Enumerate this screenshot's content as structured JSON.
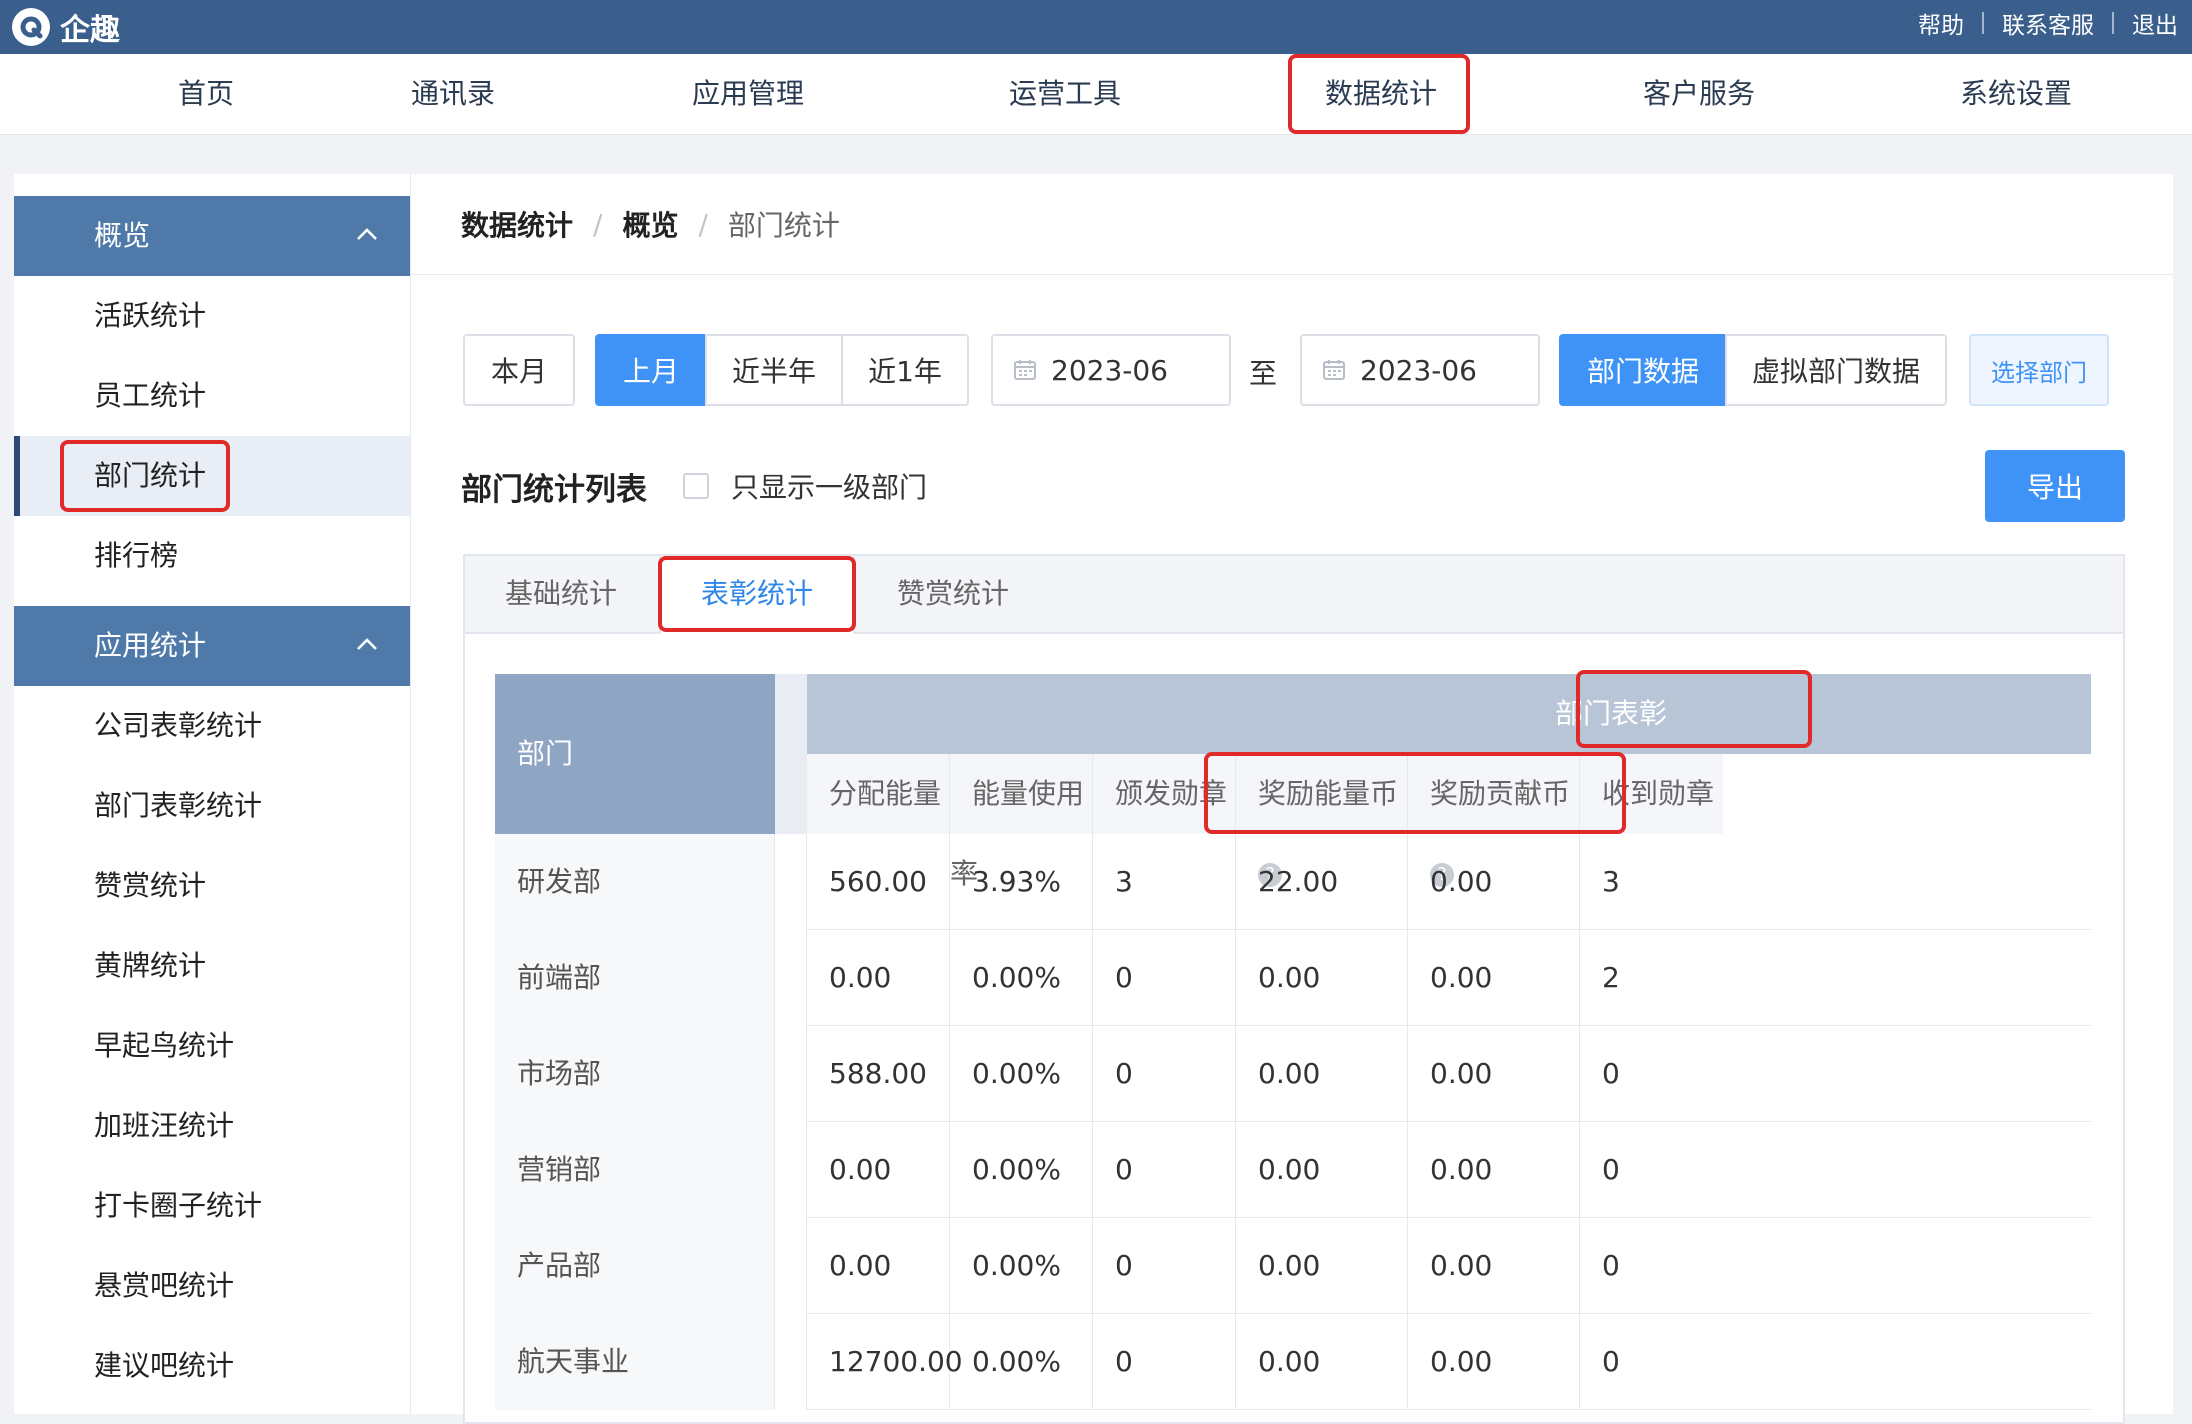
{
  "app": {
    "name": "企趣"
  },
  "top_links": [
    "帮助",
    "联系客服",
    "退出"
  ],
  "nav": [
    "首页",
    "通讯录",
    "应用管理",
    "运营工具",
    "数据统计",
    "客户服务",
    "系统设置"
  ],
  "sidebar": {
    "groups": [
      {
        "label": "概览",
        "items": [
          "活跃统计",
          "员工统计",
          "部门统计",
          "排行榜"
        ]
      },
      {
        "label": "应用统计",
        "items": [
          "公司表彰统计",
          "部门表彰统计",
          "赞赏统计",
          "黄牌统计",
          "早起鸟统计",
          "加班汪统计",
          "打卡圈子统计",
          "悬赏吧统计",
          "建议吧统计"
        ]
      }
    ]
  },
  "breadcrumb": [
    "数据统计",
    "概览",
    "部门统计"
  ],
  "filters": {
    "periods": [
      "本月",
      "上月",
      "近半年",
      "近1年"
    ],
    "date_from": "2023-06",
    "to_label": "至",
    "date_to": "2023-06",
    "data_types": [
      "部门数据",
      "虚拟部门数据"
    ],
    "select_dept": "选择部门"
  },
  "section": {
    "title": "部门统计列表",
    "checkbox_label": "只显示一级部门",
    "export": "导出"
  },
  "tabs": [
    "基础统计",
    "表彰统计",
    "赞赏统计"
  ],
  "table": {
    "dept_header": "部门",
    "group_header": "部门表彰",
    "columns": [
      "分配能量",
      "能量使用率",
      "颁发勋章",
      "奖励能量币",
      "奖励贡献币",
      "收到勋章"
    ],
    "rows": [
      [
        "研发部",
        "560.00",
        "3.93%",
        "3",
        "22.00",
        "0.00",
        "3"
      ],
      [
        "前端部",
        "0.00",
        "0.00%",
        "0",
        "0.00",
        "0.00",
        "2"
      ],
      [
        "市场部",
        "588.00",
        "0.00%",
        "0",
        "0.00",
        "0.00",
        "0"
      ],
      [
        "营销部",
        "0.00",
        "0.00%",
        "0",
        "0.00",
        "0.00",
        "0"
      ],
      [
        "产品部",
        "0.00",
        "0.00%",
        "0",
        "0.00",
        "0.00",
        "0"
      ],
      [
        "航天事业",
        "12700.00",
        "0.00%",
        "0",
        "0.00",
        "0.00",
        "0"
      ]
    ]
  },
  "colors": {
    "topbar": "#3a5f8c",
    "accent": "#3f93f6",
    "highlight": "#e02a2a",
    "sidebar_group": "#4e79a9"
  }
}
